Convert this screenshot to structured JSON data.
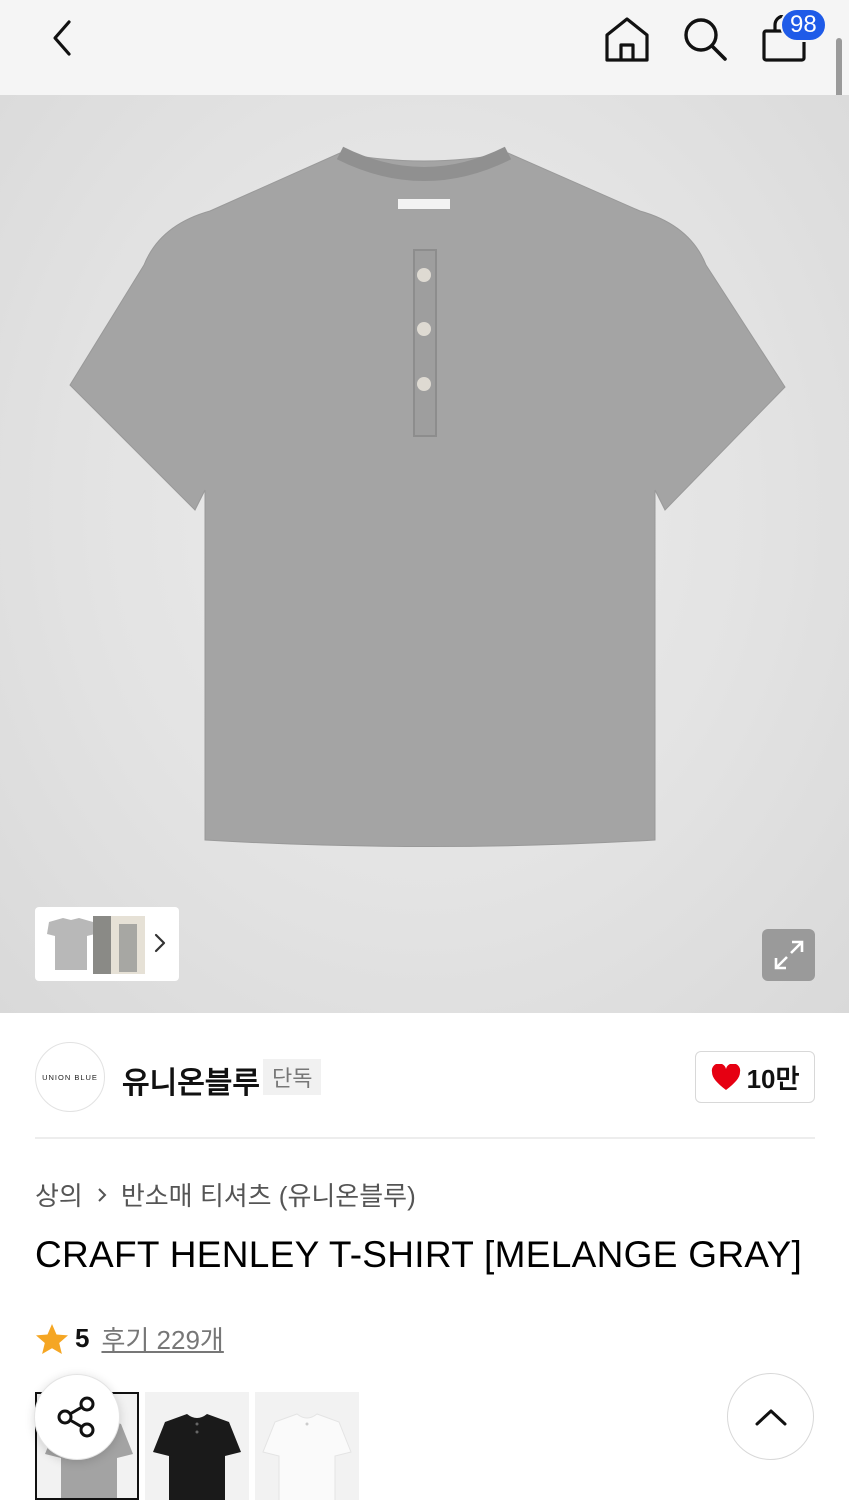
{
  "header": {
    "icons": [
      "chevron-left-icon",
      "home-icon",
      "search-icon",
      "shopping-bag-icon"
    ],
    "cart_count": "98"
  },
  "gallery": {
    "expand_icon": "expand-icon"
  },
  "brand": {
    "logo_text": "UNION BLUE",
    "name": "유니온블루",
    "tag": "단독",
    "like_count": "10만",
    "like_color": "#e60012"
  },
  "breadcrumb": {
    "items": [
      "상의",
      "반소매 티셔츠 (유니온블루)"
    ]
  },
  "product": {
    "title": "CRAFT HENLEY T-SHIRT [MELANGE GRAY]",
    "rating": "5",
    "reviews": "후기 229개",
    "star_color": "#f5a623"
  },
  "variants": [
    {
      "name": "melange-gray",
      "color": "#a0a0a0",
      "selected": true
    },
    {
      "name": "black",
      "color": "#1a1a1a",
      "selected": false
    },
    {
      "name": "white",
      "color": "#f7f7f7",
      "selected": false
    }
  ],
  "colors": {
    "badge": "#1f5be8",
    "shirt": "#a3a3a3"
  }
}
